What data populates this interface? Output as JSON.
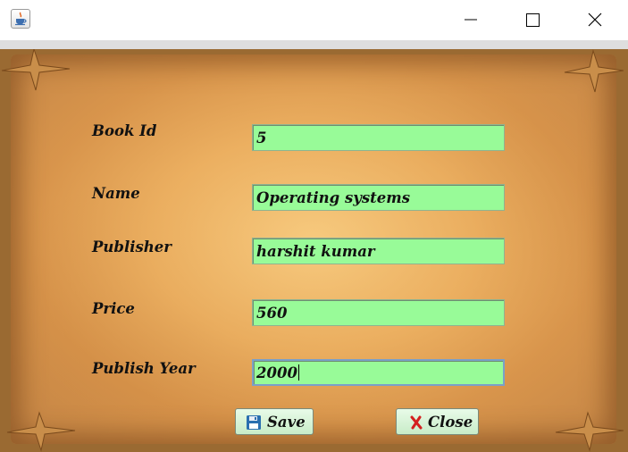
{
  "window": {
    "title": "",
    "icons": {
      "app": "java-cup-icon",
      "minimize": "minimize-icon",
      "maximize": "maximize-icon",
      "close": "close-icon"
    }
  },
  "form": {
    "book_id": {
      "label": "Book Id",
      "value": "5"
    },
    "name": {
      "label": "Name",
      "value": "Operating systems"
    },
    "publisher": {
      "label": "Publisher",
      "value": "harshit kumar"
    },
    "price": {
      "label": "Price",
      "value": "560"
    },
    "publish_year": {
      "label": "Publish Year",
      "value": "2000"
    }
  },
  "buttons": {
    "save": {
      "label": "Save",
      "icon": "floppy-disk-icon"
    },
    "close": {
      "label": "Close",
      "icon": "red-x-icon"
    }
  },
  "colors": {
    "field_bg": "#98fb98",
    "paper": "#e8a860",
    "save_icon": "#2a6fb0",
    "close_icon": "#d42020"
  }
}
